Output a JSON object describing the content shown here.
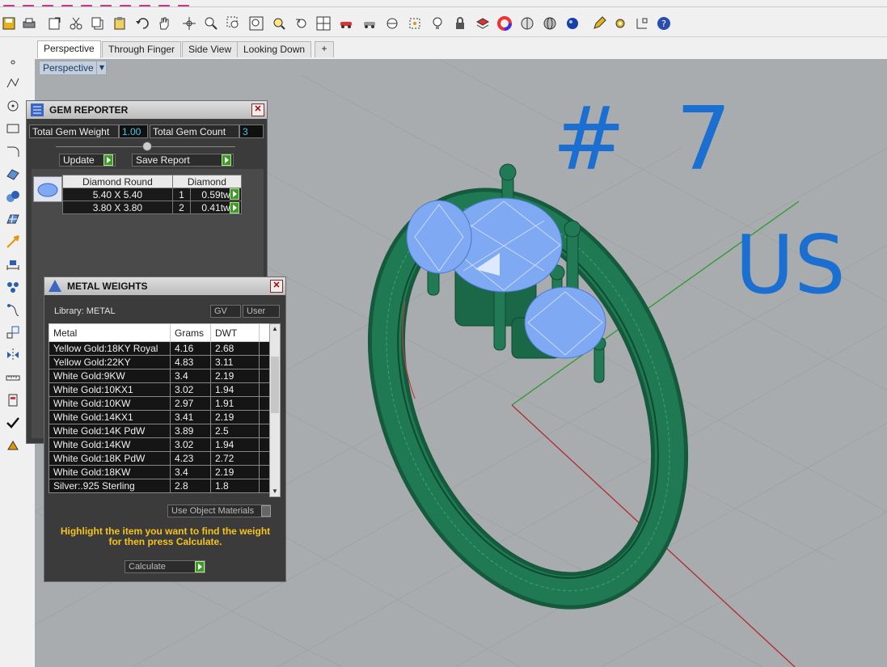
{
  "tabs": [
    "Perspective",
    "Through Finger",
    "Side View",
    "Looking Down"
  ],
  "viewport": {
    "label": "Perspective"
  },
  "gem_reporter": {
    "title": "GEM REPORTER",
    "total_weight_label": "Total Gem Weight",
    "total_weight_value": "1.00",
    "total_count_label": "Total Gem Count",
    "total_count_value": "3",
    "update_label": "Update",
    "save_report_label": "Save Report",
    "table_headers": [
      "Diamond Round",
      "Diamond"
    ],
    "rows": [
      {
        "size": "5.40 X 5.40",
        "count": "1",
        "weight": "0.59tw"
      },
      {
        "size": "3.80 X 3.80",
        "count": "2",
        "weight": "0.41tw"
      }
    ]
  },
  "metal_weights": {
    "title": "METAL WEIGHTS",
    "library_label": "Library: METAL",
    "gv_label": "GV",
    "user_label": "User",
    "headers": [
      "Metal",
      "Grams",
      "DWT"
    ],
    "rows": [
      {
        "metal": "Yellow Gold:18KY Royal",
        "grams": "4.16",
        "dwt": "2.68"
      },
      {
        "metal": "Yellow Gold:22KY",
        "grams": "4.83",
        "dwt": "3.11"
      },
      {
        "metal": "White Gold:9KW",
        "grams": "3.4",
        "dwt": "2.19"
      },
      {
        "metal": "White Gold:10KX1",
        "grams": "3.02",
        "dwt": "1.94"
      },
      {
        "metal": "White Gold:10KW",
        "grams": "2.97",
        "dwt": "1.91"
      },
      {
        "metal": "White Gold:14KX1",
        "grams": "3.41",
        "dwt": "2.19"
      },
      {
        "metal": "White Gold:14K PdW",
        "grams": "3.89",
        "dwt": "2.5"
      },
      {
        "metal": "White Gold:14KW",
        "grams": "3.02",
        "dwt": "1.94"
      },
      {
        "metal": "White Gold:18K PdW",
        "grams": "4.23",
        "dwt": "2.72"
      },
      {
        "metal": "White Gold:18KW",
        "grams": "3.4",
        "dwt": "2.19"
      },
      {
        "metal": "Silver:.925 Sterling",
        "grams": "2.8",
        "dwt": "1.8"
      }
    ],
    "use_object_materials_label": "Use Object Materials",
    "hint_line1": "Highlight the item you want to find the weight",
    "hint_line2": "for then press Calculate.",
    "calculate_label": "Calculate"
  },
  "annotation": {
    "line1": "# 7",
    "line2": "US"
  },
  "colors": {
    "ring": "#1f7a54",
    "gem": "#7fa9f2",
    "viewport_bg": "#a9acaf",
    "hint": "#f5c31b",
    "field_value": "#43c7e8"
  }
}
